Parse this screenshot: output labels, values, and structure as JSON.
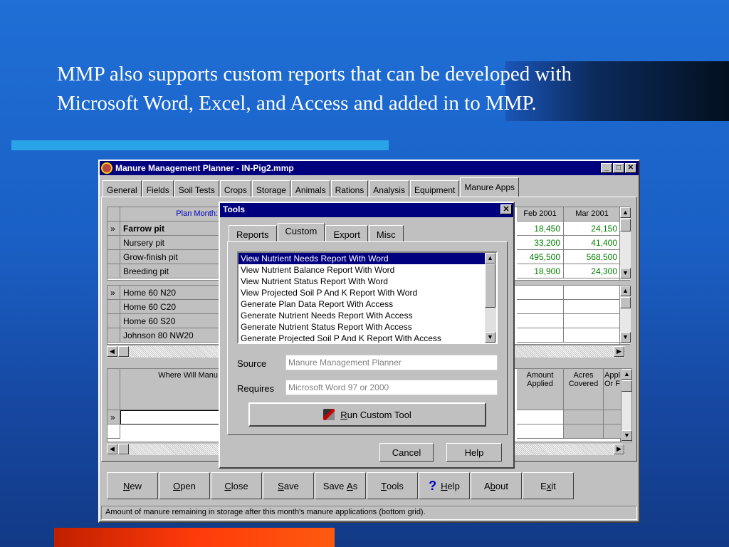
{
  "slide": {
    "title_pre": "MMP also supports ",
    "title_highlight": "custom reports",
    "title_post": " that can be developed with Microsoft Word, Excel, and Access and added in to MMP."
  },
  "window": {
    "title": "Manure Management Planner - IN-Pig2.mmp",
    "tabs": [
      "General",
      "Fields",
      "Soil Tests",
      "Crops",
      "Storage",
      "Animals",
      "Rations",
      "Analysis",
      "Equipment",
      "Manure Apps"
    ],
    "active_tab": "Manure Apps"
  },
  "top_grid": {
    "plan_month_label": "Plan Month:",
    "months": [
      "Feb 2001",
      "Mar 2001"
    ],
    "rows": [
      {
        "name": "Farrow pit",
        "bold": true,
        "feb": "18,450",
        "mar": "24,150"
      },
      {
        "name": "Nursery pit",
        "feb": "33,200",
        "mar": "41,400"
      },
      {
        "name": "Grow-finish pit",
        "feb": "495,500",
        "mar": "568,500"
      },
      {
        "name": "Breeding pit",
        "feb": "18,900",
        "mar": "24,300"
      }
    ],
    "row_marker": "»"
  },
  "field_grid": {
    "rows": [
      "Home 60 N20",
      "Home 60 C20",
      "Home 60 S20",
      "Johnson 80 NW20"
    ]
  },
  "bottom_grid": {
    "col_where": "Where Will Manu",
    "col_amount": "Amount Applied",
    "col_acres": "Acres Covered",
    "col_appl": "Appl Or F"
  },
  "toolbar": {
    "new": {
      "u": "N",
      "rest": "ew"
    },
    "open": {
      "u": "O",
      "rest": "pen"
    },
    "close": {
      "u": "C",
      "rest": "lose"
    },
    "save": {
      "u": "S",
      "rest": "ave"
    },
    "save_as": {
      "pre": "Save ",
      "u": "A",
      "rest": "s"
    },
    "tools": {
      "u": "T",
      "rest": "ools"
    },
    "help": {
      "u": "H",
      "rest": "elp"
    },
    "about": {
      "pre": "A",
      "u": "b",
      "rest": "out"
    },
    "exit": {
      "pre": "E",
      "u": "x",
      "rest": "it"
    }
  },
  "status_text": "Amount of manure remaining in storage after this month's manure applications (bottom grid).",
  "dialog": {
    "title": "Tools",
    "tabs": [
      "Reports",
      "Custom",
      "Export",
      "Misc"
    ],
    "active_tab": "Custom",
    "items": [
      "View Nutrient Needs Report With Word",
      "View Nutrient Balance Report With Word",
      "View Nutrient Status Report With Word",
      "View Projected Soil P And K Report With Word",
      "Generate Plan Data Report With Access",
      "Generate Nutrient Needs Report With Access",
      "Generate Nutrient Status Report With Access",
      "Generate Projected Soil P And K Report With Access"
    ],
    "selected_index": 0,
    "source_label": "Source",
    "source_value": "Manure Management Planner",
    "requires_label": "Requires",
    "requires_value": "Microsoft Word 97 or 2000",
    "run_u": "R",
    "run_rest": "un Custom Tool",
    "cancel": "Cancel",
    "help": "Help"
  },
  "colors": {
    "titlebar": "#00007f",
    "accent": "#2aa4e8",
    "number_green": "#008000"
  }
}
